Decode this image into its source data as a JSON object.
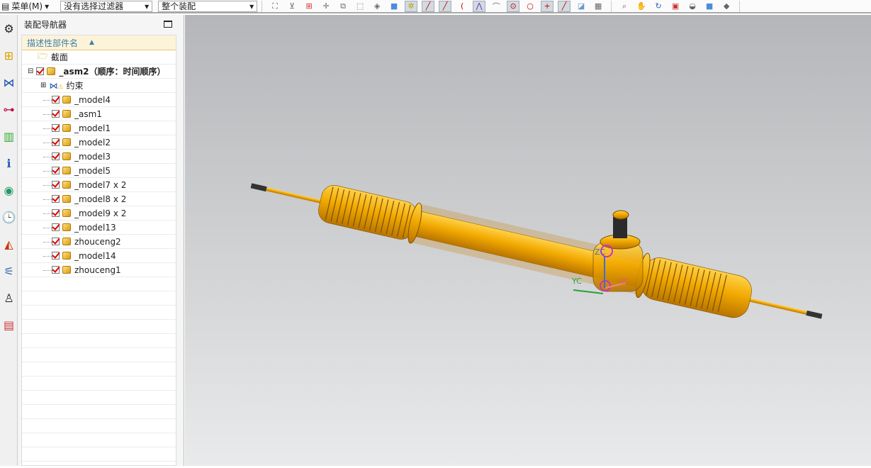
{
  "toolbar": {
    "menu_label": "菜单(M)",
    "filter_value": "没有选择过滤器",
    "scope_value": "整个装配"
  },
  "navigator": {
    "title": "装配导航器",
    "column_header": "描述性部件名",
    "section": "截面",
    "root": "_asm2（顺序：时间顺序）",
    "constraints": "约束",
    "items": [
      "_model4",
      "_asm1",
      "_model1",
      "_model2",
      "_model3",
      "_model5",
      "_model7 x 2",
      "_model8 x 2",
      "_model9 x 2",
      "_model13",
      "zhouceng2",
      "_model14",
      "zhouceng1"
    ]
  },
  "viewport": {
    "axis_labels": {
      "x": "XC",
      "y": "YC",
      "z": "ZC"
    },
    "part_color": "#f2a900"
  }
}
